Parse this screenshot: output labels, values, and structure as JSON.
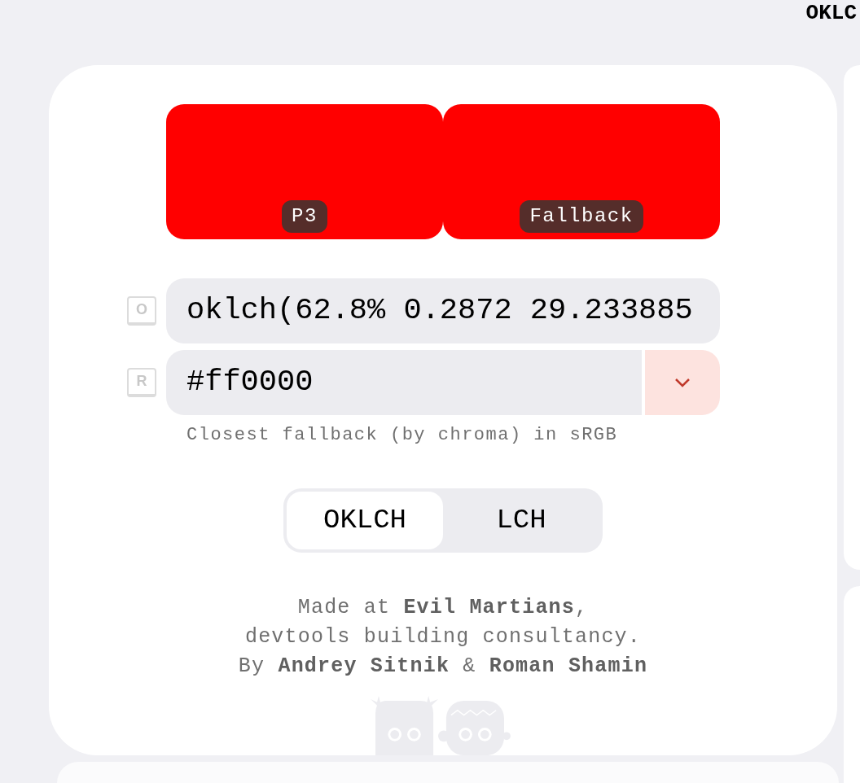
{
  "header": {
    "title": "OKLC"
  },
  "preview": {
    "swatches": [
      {
        "label": "P3",
        "color": "#ff0000"
      },
      {
        "label": "Fallback",
        "color": "#ff0000"
      }
    ]
  },
  "fields": [
    {
      "kind": "text",
      "hotkey": "O",
      "value": "oklch(62.8% 0.2872 29.233885"
    },
    {
      "kind": "select",
      "hotkey": "R",
      "value": "#ff0000"
    }
  ],
  "note": "Closest fallback (by chroma) in sRGB",
  "modes": [
    {
      "label": "OKLCH",
      "selected": true
    },
    {
      "label": "LCH",
      "selected": false
    }
  ],
  "credits": [
    "Made at **Evil Martians**,",
    "devtools building consultancy.",
    "By **Andrey Sitnik** & **Roman Shamin**"
  ]
}
